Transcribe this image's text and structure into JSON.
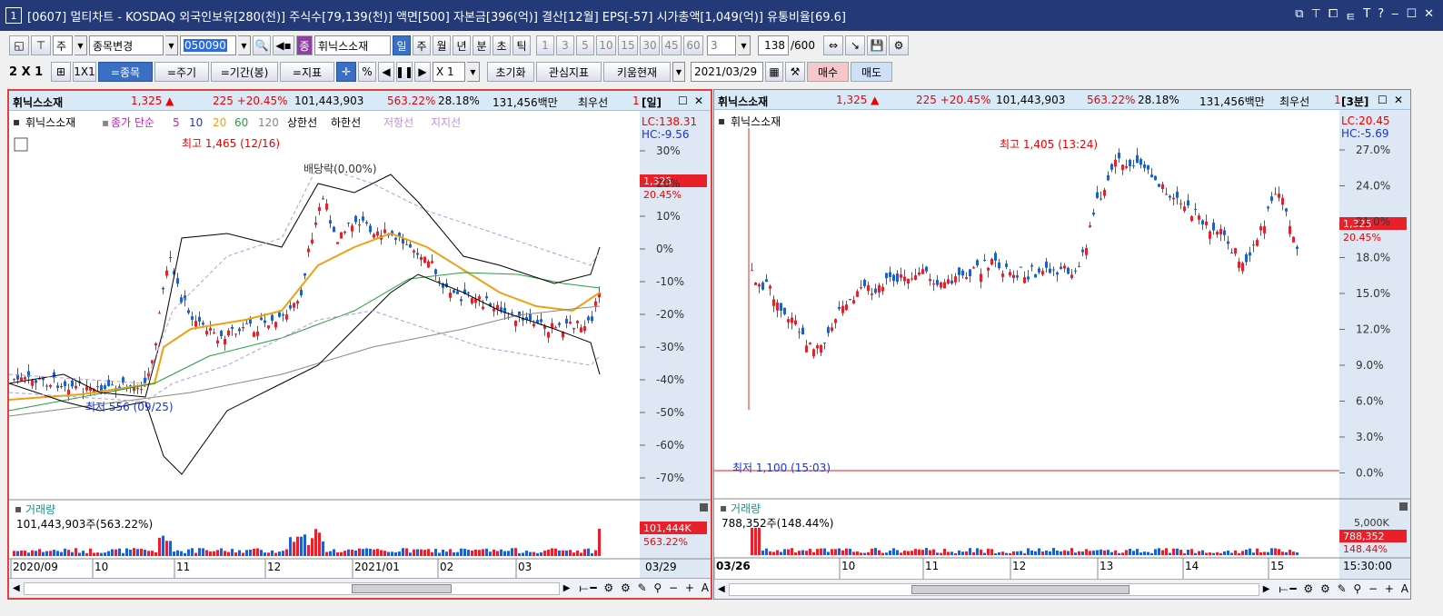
{
  "title": {
    "num": "1",
    "text": "[0607] 멀티차트 - KOSDAQ 외국인보유[280(천)] 주식수[79,139(천)] 액면[500] 자본금[396(억)] 결산[12월] EPS[-57] 시가총액[1,049(억)] 유통비율[69.6]"
  },
  "toolbar1": {
    "period_unit": "주",
    "stock_change": "종목변경",
    "code": "050090",
    "stock_badge": "종",
    "stock_name": "휘닉스소재",
    "tabs": [
      "일",
      "주",
      "월",
      "년",
      "분",
      "초",
      "틱"
    ],
    "minutes": [
      "1",
      "3",
      "5",
      "10",
      "15",
      "30",
      "45",
      "60"
    ],
    "custom_val": "3",
    "count": "138",
    "count_total": "/600"
  },
  "toolbar2": {
    "layout": "2 X 1",
    "one": "1X1",
    "b1": "=종목",
    "b2": "=주기",
    "b3": "=기간(봉)",
    "b4": "=지표",
    "pct": "%",
    "mult": "X 1",
    "reset": "초기화",
    "interest": "관심지표",
    "kiwoom": "키움현재",
    "date": "2021/03/29",
    "buy": "매수",
    "sell": "매도"
  },
  "left": {
    "header": {
      "name": "휘닉스소재",
      "price": "1,325 ▲",
      "change": "225 +20.45%",
      "volume": "101,443,903",
      "vol_ratio": "563.22%",
      "turnover": "28.18%",
      "amount": "131,456백만",
      "rank": "최우선",
      "one": "1",
      "period": "[일]"
    },
    "legend": {
      "name": "휘닉스소재",
      "close_simple": "종가 단순",
      "ma5": "5",
      "ma10": "10",
      "ma20": "20",
      "ma60": "60",
      "ma120": "120",
      "upper": "상한선",
      "lower": "하한선",
      "resist": "저항선",
      "support": "지지선"
    },
    "lc": "LC:138.31",
    "hc": "HC:-9.56",
    "high_label": "최고 1,465 (12/16)",
    "low_label": "최저 556 (09/25)",
    "div_label": "배당락(0.00%)",
    "price_tag": "1,325",
    "pct_tag": "20.45%",
    "yticks": [
      "30%",
      "20%",
      "10%",
      "0%",
      "-10%",
      "-20%",
      "-30%",
      "-40%",
      "-50%",
      "-60%",
      "-70%"
    ],
    "vol_title": "거래량",
    "vol_value": "101,443,903주(563.22%)",
    "vol_tag": "101,444K",
    "vol_pct": "563.22%",
    "xticks": [
      "2020/09",
      "10",
      "11",
      "12",
      "2021/01",
      "02",
      "03"
    ],
    "xright": "03/29"
  },
  "right": {
    "header": {
      "name": "휘닉스소재",
      "price": "1,325 ▲",
      "change": "225 +20.45%",
      "volume": "101,443,903",
      "vol_ratio": "563.22%",
      "turnover": "28.18%",
      "amount": "131,456백만",
      "rank": "최우선",
      "one": "1",
      "period": "[3분]"
    },
    "legend_name": "휘닉스소재",
    "lc": "LC:20.45",
    "hc": "HC:-5.69",
    "high_label": "최고 1,405 (13:24)",
    "low_label": "최저 1,100 (15:03)",
    "price_tag": "1,325",
    "pct_tag": "20.45%",
    "yticks": [
      "27.0%",
      "24.0%",
      "21.0%",
      "18.0%",
      "15.0%",
      "12.0%",
      "9.0%",
      "6.0%",
      "3.0%",
      "0.0%"
    ],
    "vol_title": "거래량",
    "vol_value": "788,352주(148.44%)",
    "vol_tag": "788,352",
    "vol_pct": "148.44%",
    "vol_tick": "5,000K",
    "xticks": [
      "03/26",
      "10",
      "11",
      "12",
      "13",
      "14",
      "15"
    ],
    "xright": "15:30:00"
  },
  "colors": {
    "up": "#e8202a",
    "down": "#1c5fd0",
    "ma5": "#c020c0",
    "ma10": "#1c33d0",
    "ma20": "#f0a010",
    "ma60": "#20a040",
    "ma120": "#888888"
  }
}
